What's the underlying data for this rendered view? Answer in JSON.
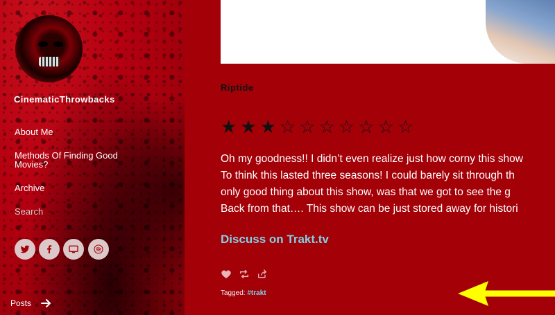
{
  "sidebar": {
    "blog_name": "CinematicThrowbacks",
    "nav": [
      {
        "label": "About Me"
      },
      {
        "label": "Methods Of Finding Good Movies?"
      },
      {
        "label": "Archive"
      }
    ],
    "search_placeholder": "Search",
    "social": [
      "twitter-icon",
      "facebook-icon",
      "tv-icon",
      "spotify-icon"
    ],
    "posts_label": "Posts"
  },
  "post": {
    "title": "Riptide",
    "rating": {
      "filled": 3,
      "total": 10
    },
    "body_lines": [
      "Oh my goodness!! I didn’t even realize just how corny this show",
      "To think this lasted three seasons! I could barely sit through th",
      "only good thing about this show, was that we got to see the g",
      "Back from that…. This show can be just stored away for histori"
    ],
    "discuss_link": "Discuss on Trakt.tv",
    "tagged_label": "Tagged: ",
    "tag": "#trakt"
  },
  "colors": {
    "background": "#a30008",
    "link": "#7fd2e6",
    "annotation_arrow": "#ffff00"
  }
}
